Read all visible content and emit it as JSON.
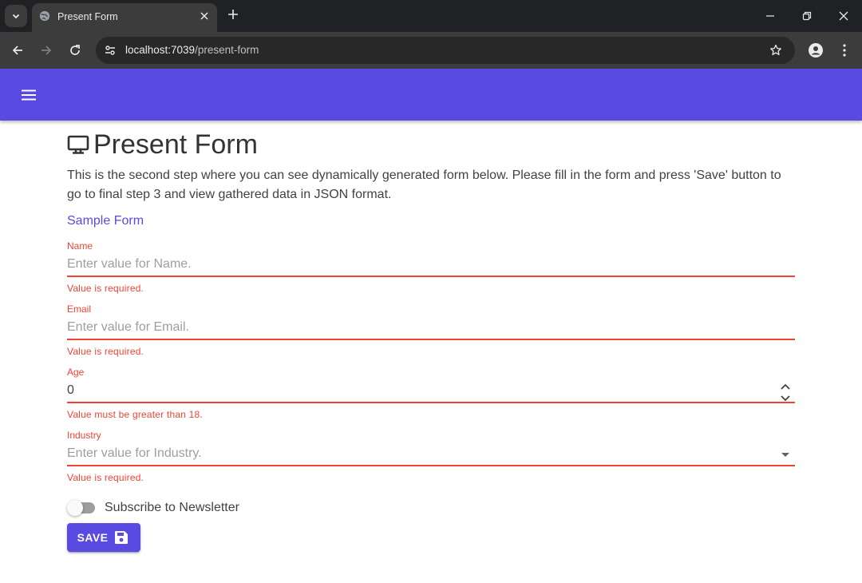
{
  "browser": {
    "tab_title": "Present Form",
    "url_host": "localhost:7039",
    "url_path": "/present-form",
    "icons": {
      "tab_search": "chevron-down-icon",
      "favicon": "globe-icon",
      "tab_close": "close-icon",
      "new_tab": "plus-icon",
      "minimize": "minimize-icon",
      "restore": "restore-icon",
      "close_window": "close-icon",
      "back": "arrow-left-icon",
      "forward": "arrow-right-icon",
      "reload": "reload-icon",
      "site_info": "tune-icon",
      "bookmark": "star-icon",
      "profile": "person-icon",
      "menu": "more-vert-icon"
    }
  },
  "appbar": {
    "color": "#594ae2",
    "menu_icon": "hamburger-icon"
  },
  "page": {
    "title": "Present Form",
    "title_icon": "monitor-icon",
    "intro": "This is the second step where you can see dynamically generated form below. Please fill in the form and press 'Save' button to go to final step 3 and view gathered data in JSON format."
  },
  "form": {
    "title": "Sample Form",
    "error_color": "#f44336",
    "fields": [
      {
        "label": "Name",
        "placeholder": "Enter value for Name.",
        "value": "",
        "helper": "Value is required."
      },
      {
        "label": "Email",
        "placeholder": "Enter value for Email.",
        "value": "",
        "helper": "Value is required."
      },
      {
        "label": "Age",
        "placeholder": "",
        "value": "0",
        "helper": "Value must be greater than 18."
      },
      {
        "label": "Industry",
        "placeholder": "Enter value for Industry.",
        "value": "",
        "helper": "Value is required."
      }
    ],
    "newsletter": {
      "label": "Subscribe to Newsletter",
      "checked": false
    },
    "save_label": "SAVE",
    "save_icon": "save-icon"
  }
}
